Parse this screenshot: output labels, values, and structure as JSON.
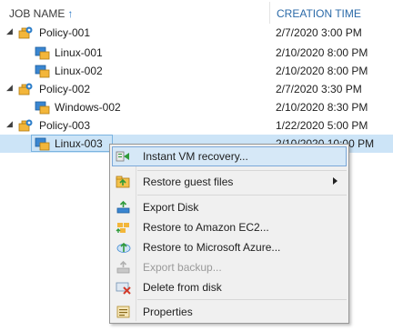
{
  "columns": {
    "job_name": "JOB NAME",
    "sort_arrow": "↑",
    "creation_time": "CREATION TIME"
  },
  "rows": [
    {
      "name": "Policy-001",
      "time": "2/7/2020 3:00 PM",
      "type": "policy",
      "expanded": true
    },
    {
      "name": "Linux-001",
      "time": "2/10/2020 8:00 PM",
      "type": "vm"
    },
    {
      "name": "Linux-002",
      "time": "2/10/2020 8:00 PM",
      "type": "vm"
    },
    {
      "name": "Policy-002",
      "time": "2/7/2020 3:30 PM",
      "type": "policy",
      "expanded": true
    },
    {
      "name": "Windows-002",
      "time": "2/10/2020 8:30 PM",
      "type": "vm"
    },
    {
      "name": "Policy-003",
      "time": "1/22/2020 5:00 PM",
      "type": "policy",
      "expanded": true
    },
    {
      "name": "Linux-003",
      "time": "2/10/2020 10:00 PM",
      "type": "vm",
      "selected": true
    }
  ],
  "context_menu": {
    "items": [
      {
        "label": "Instant VM recovery...",
        "icon": "instant-recovery-icon",
        "hover": true
      },
      {
        "label": "Restore guest files",
        "icon": "guest-files-icon",
        "submenu": true
      },
      {
        "label": "Export Disk",
        "icon": "export-disk-icon"
      },
      {
        "label": "Restore to Amazon EC2...",
        "icon": "amazon-ec2-icon"
      },
      {
        "label": "Restore to Microsoft Azure...",
        "icon": "azure-icon"
      },
      {
        "label": "Export backup...",
        "icon": "export-backup-icon",
        "disabled": true
      },
      {
        "label": "Delete from disk",
        "icon": "delete-disk-icon"
      },
      {
        "label": "Properties",
        "icon": "properties-icon"
      }
    ]
  },
  "colors": {
    "header_text": "#2b6aa8",
    "selection": "#cce4f7",
    "menu_bg": "#f0f0f0",
    "menu_hover": "#d6e8f7"
  }
}
